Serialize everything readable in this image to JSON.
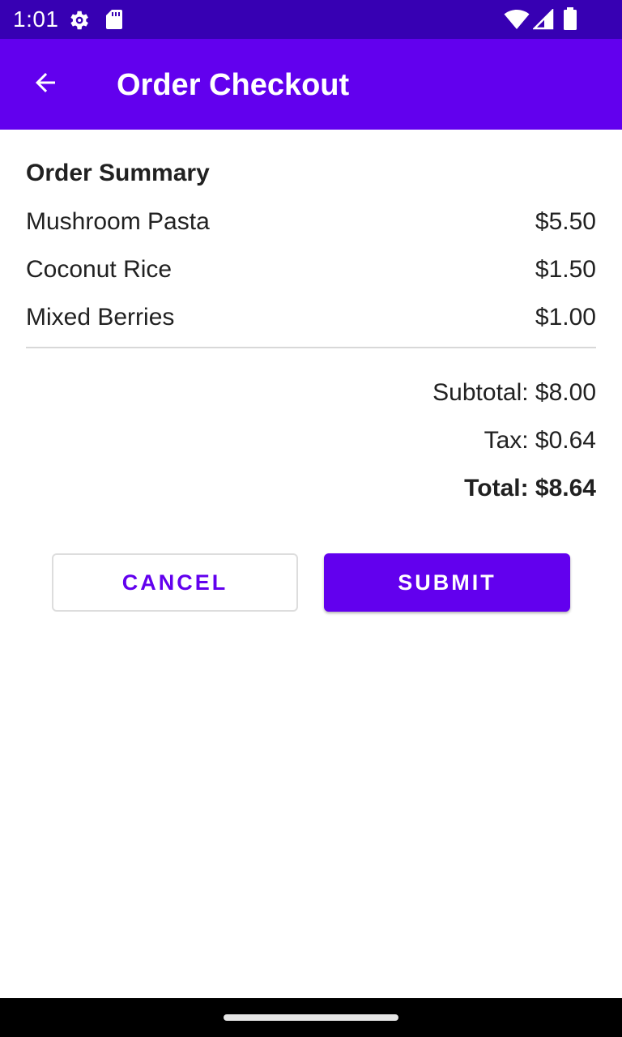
{
  "status_bar": {
    "time": "1:01",
    "icons": [
      "settings-gear-icon",
      "sd-card-icon",
      "wifi-icon",
      "cell-signal-icon",
      "battery-icon"
    ],
    "background": "#3700B3"
  },
  "app_bar": {
    "title": "Order Checkout",
    "back_icon": "arrow-left-icon",
    "background": "#6200EE"
  },
  "order_summary": {
    "title": "Order Summary",
    "items": [
      {
        "name": "Mushroom Pasta",
        "price": "$5.50"
      },
      {
        "name": "Coconut Rice",
        "price": "$1.50"
      },
      {
        "name": "Mixed Berries",
        "price": "$1.00"
      }
    ],
    "subtotal": "Subtotal: $8.00",
    "tax": "Tax: $0.64",
    "total": "Total: $8.64"
  },
  "actions": {
    "cancel_label": "CANCEL",
    "submit_label": "SUBMIT"
  },
  "nav_bar": {
    "handle_icon": "home-gesture-handle"
  }
}
